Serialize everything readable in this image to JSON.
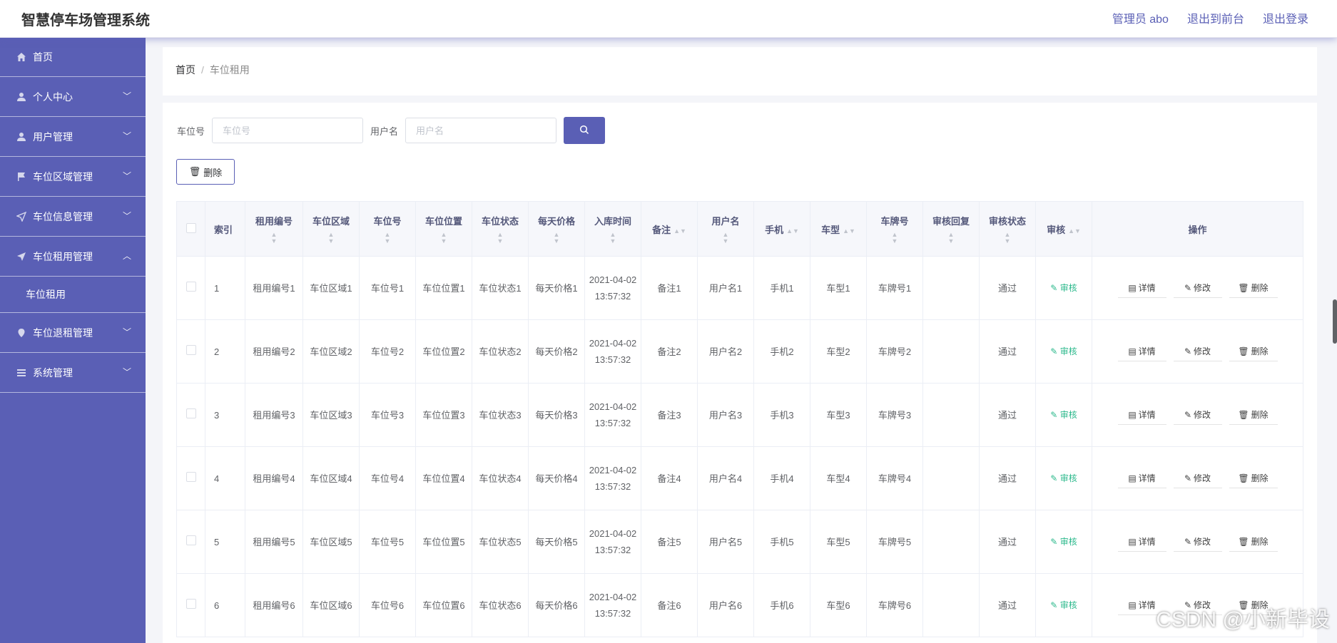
{
  "app": {
    "title": "智慧停车场管理系统",
    "admin_label": "管理员 abo",
    "front_label": "退出到前台",
    "logout_label": "退出登录"
  },
  "sidebar": {
    "items": [
      {
        "label": "首页",
        "icon": "home-icon"
      },
      {
        "label": "个人中心",
        "icon": "user-icon"
      },
      {
        "label": "用户管理",
        "icon": "user-icon"
      },
      {
        "label": "车位区域管理",
        "icon": "flag-icon"
      },
      {
        "label": "车位信息管理",
        "icon": "send-icon"
      },
      {
        "label": "车位租用管理",
        "icon": "send-icon"
      },
      {
        "label": "车位退租管理",
        "icon": "location-icon"
      },
      {
        "label": "系统管理",
        "icon": "menu-icon"
      }
    ],
    "sub_item": "车位租用"
  },
  "breadcrumb": {
    "home": "首页",
    "current": "车位租用"
  },
  "search": {
    "space_label": "车位号",
    "space_placeholder": "车位号",
    "user_label": "用户名",
    "user_placeholder": "用户名"
  },
  "toolbar": {
    "delete_label": "删除"
  },
  "table": {
    "headers": [
      "索引",
      "租用编号",
      "车位区域",
      "车位号",
      "车位位置",
      "车位状态",
      "每天价格",
      "入库时间",
      "备注",
      "用户名",
      "手机",
      "车型",
      "车牌号",
      "审核回复",
      "审核状态",
      "审核",
      "操作"
    ],
    "rows": [
      {
        "index": "1",
        "rent_no": "租用编号1",
        "area": "车位区域1",
        "space": "车位号1",
        "position": "车位位置1",
        "status": "车位状态1",
        "price": "每天价格1",
        "time": "2021-04-02 13:57:32",
        "remark": "备注1",
        "user": "用户名1",
        "phone": "手机1",
        "car_type": "车型1",
        "plate": "车牌号1",
        "reply": "",
        "audit_status": "通过"
      },
      {
        "index": "2",
        "rent_no": "租用编号2",
        "area": "车位区域2",
        "space": "车位号2",
        "position": "车位位置2",
        "status": "车位状态2",
        "price": "每天价格2",
        "time": "2021-04-02 13:57:32",
        "remark": "备注2",
        "user": "用户名2",
        "phone": "手机2",
        "car_type": "车型2",
        "plate": "车牌号2",
        "reply": "",
        "audit_status": "通过"
      },
      {
        "index": "3",
        "rent_no": "租用编号3",
        "area": "车位区域3",
        "space": "车位号3",
        "position": "车位位置3",
        "status": "车位状态3",
        "price": "每天价格3",
        "time": "2021-04-02 13:57:32",
        "remark": "备注3",
        "user": "用户名3",
        "phone": "手机3",
        "car_type": "车型3",
        "plate": "车牌号3",
        "reply": "",
        "audit_status": "通过"
      },
      {
        "index": "4",
        "rent_no": "租用编号4",
        "area": "车位区域4",
        "space": "车位号4",
        "position": "车位位置4",
        "status": "车位状态4",
        "price": "每天价格4",
        "time": "2021-04-02 13:57:32",
        "remark": "备注4",
        "user": "用户名4",
        "phone": "手机4",
        "car_type": "车型4",
        "plate": "车牌号4",
        "reply": "",
        "audit_status": "通过"
      },
      {
        "index": "5",
        "rent_no": "租用编号5",
        "area": "车位区域5",
        "space": "车位号5",
        "position": "车位位置5",
        "status": "车位状态5",
        "price": "每天价格5",
        "time": "2021-04-02 13:57:32",
        "remark": "备注5",
        "user": "用户名5",
        "phone": "手机5",
        "car_type": "车型5",
        "plate": "车牌号5",
        "reply": "",
        "audit_status": "通过"
      },
      {
        "index": "6",
        "rent_no": "租用编号6",
        "area": "车位区域6",
        "space": "车位号6",
        "position": "车位位置6",
        "status": "车位状态6",
        "price": "每天价格6",
        "time": "2021-04-02 13:57:32",
        "remark": "备注6",
        "user": "用户名6",
        "phone": "手机6",
        "car_type": "车型6",
        "plate": "车牌号6",
        "reply": "",
        "audit_status": "通过"
      }
    ],
    "actions": {
      "audit": "审核",
      "detail": "详情",
      "edit": "修改",
      "delete": "删除"
    }
  },
  "watermark": "CSDN @小新毕设",
  "colors": {
    "primary": "#5a5fb5",
    "audit_green": "#2cb98c",
    "header_bg": "#f6f7fb"
  }
}
